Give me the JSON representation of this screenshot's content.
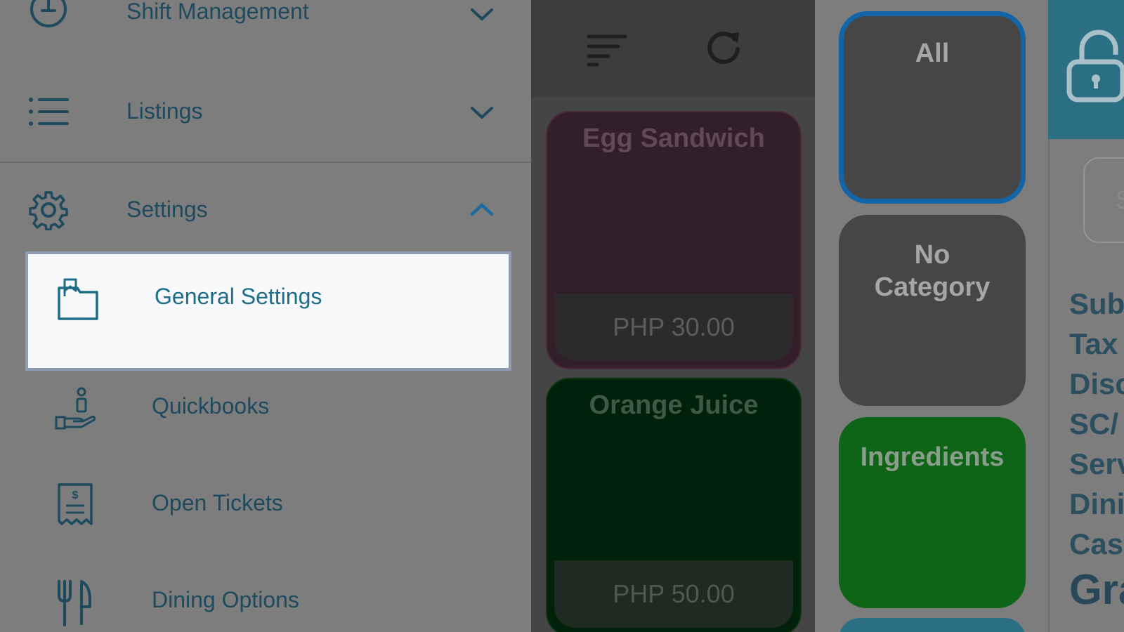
{
  "background": {
    "toolbar": {
      "sort_icon": "sort-lines-icon",
      "refresh_icon": "refresh-icon"
    },
    "items": [
      {
        "name": "Egg Sandwich",
        "price": "PHP 30.00",
        "color": "#331f2b"
      },
      {
        "name": "Orange Juice",
        "price": "PHP 50.00",
        "color": "#00220a"
      }
    ],
    "categories": [
      {
        "label": "All",
        "selected": true,
        "color": "#464646"
      },
      {
        "label": "No Category",
        "selected": false,
        "color": "#464646"
      },
      {
        "label": "Ingredients",
        "selected": false,
        "color": "#0e6417"
      }
    ],
    "summary_partial": [
      "Sub",
      "Tax",
      "Disc",
      "SC/",
      "Serv",
      "Dini",
      "Cas"
    ],
    "grand_partial": "Gra",
    "search_partial": "S"
  },
  "drawer": {
    "nav": [
      {
        "label": "Shift Management",
        "icon": "clock-icon",
        "expanded": false
      },
      {
        "label": "Listings",
        "icon": "list-icon",
        "expanded": false
      },
      {
        "label": "Settings",
        "icon": "gear-icon",
        "expanded": true
      }
    ],
    "settings_sub": [
      {
        "label": "General Settings",
        "icon": "folder-icon",
        "active": true
      },
      {
        "label": "Quickbooks",
        "icon": "hand-coin-icon",
        "active": false
      },
      {
        "label": "Open Tickets",
        "icon": "receipt-icon",
        "active": false
      },
      {
        "label": "Dining Options",
        "icon": "utensils-icon",
        "active": false
      }
    ]
  },
  "colors": {
    "accent": "#1e6c88",
    "selected_outline": "#1464a8",
    "drawer_text": "#1e4a5e"
  }
}
